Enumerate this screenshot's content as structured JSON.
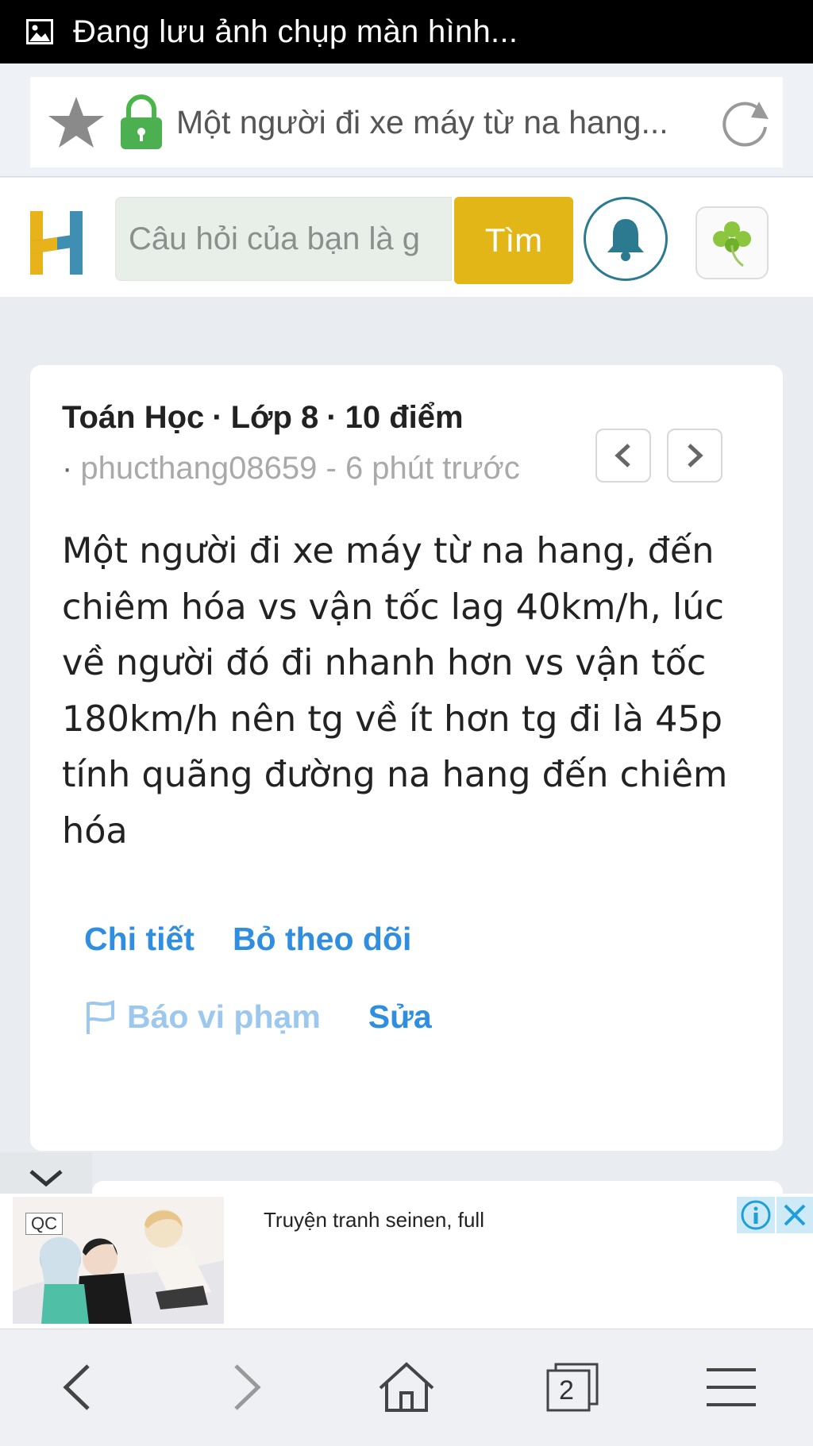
{
  "statusbar": {
    "text": "Đang lưu ảnh chụp màn hình...",
    "icon": "image-icon"
  },
  "urlbar": {
    "title": "Một người đi xe máy từ na hang...",
    "icons": [
      "star-icon",
      "lock-icon",
      "reload-icon"
    ]
  },
  "header": {
    "logo": "H",
    "search_placeholder": "Câu hỏi của bạn là g",
    "search_button": "Tìm",
    "icons": [
      "bell-icon",
      "clover-icon"
    ]
  },
  "question": {
    "subject": "Toán Học",
    "grade": "Lớp 8",
    "points": "10 điểm",
    "author_line": "phucthang08659 - 6 phút trước",
    "text": "Một người đi xe máy từ na hang, đến chiêm hóa vs vận tốc lag 40km/h, lúc về người đó đi nhanh hơn vs vận tốc 180km/h nên tg về ít hơn tg đi là 45p tính quãng đường na hang đến chiêm hóa",
    "actions": {
      "details": "Chi tiết",
      "unfollow": "Bỏ theo dõi",
      "report": "Báo vi phạm",
      "edit": "Sửa"
    }
  },
  "ad": {
    "badge": "QC",
    "text": "Truyện tranh seinen, full"
  },
  "bottom_nav": {
    "tabs_count": "2"
  },
  "colors": {
    "accent_yellow": "#e2b616",
    "link_blue": "#2f8ee0",
    "bell_teal": "#2b7a8f"
  }
}
